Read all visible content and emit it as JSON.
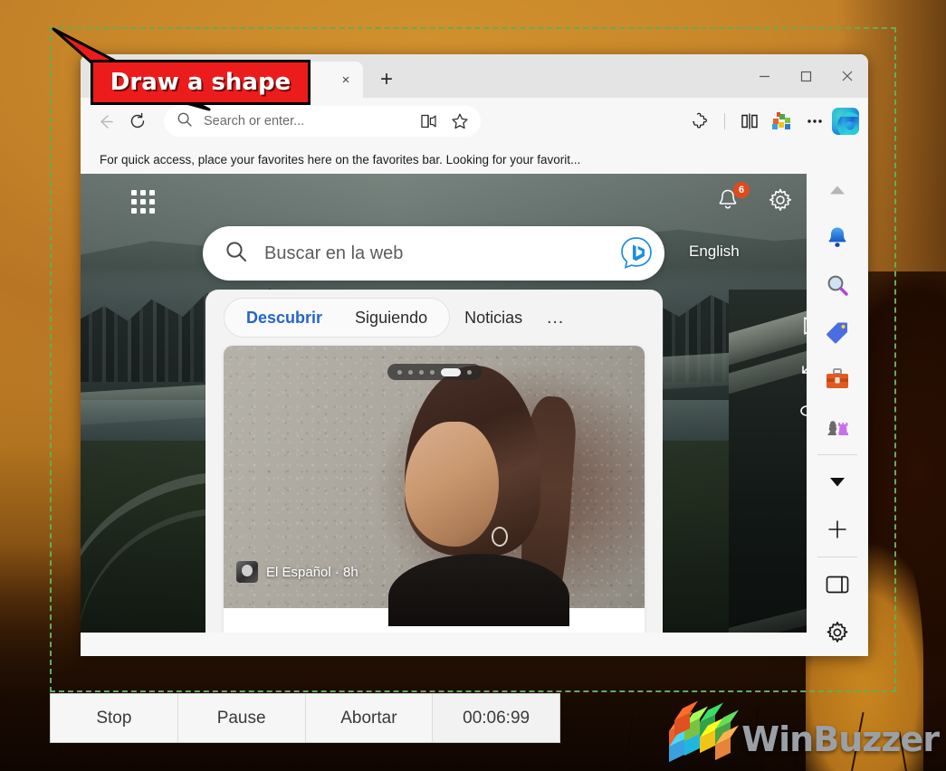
{
  "annotation": {
    "label": "Draw a shape",
    "color": "#ed1c1c"
  },
  "browser": {
    "tab": {
      "title": "",
      "close_label": "×",
      "favicon": "circle-favicon"
    },
    "newtab_label": "+",
    "window_controls": {
      "minimize": "–",
      "maximize": "□",
      "close": "✕"
    },
    "toolbar": {
      "back_icon": "back-arrow-icon",
      "refresh_icon": "refresh-icon",
      "omnibox_placeholder": "Search or enter...",
      "read_aloud_icon": "read-aloud-icon",
      "favorite_icon": "star-icon",
      "extensions_icon": "puzzle-piece-icon",
      "split_screen_icon": "split-screen-icon",
      "collections_icon": "collections-cubes-icon",
      "settings_more_icon": "ellipsis-icon",
      "copilot_icon": "copilot-icon"
    },
    "favorites_bar": {
      "text": "For quick access, place your favorites here on the favorites bar. Looking for your favorit..."
    }
  },
  "bing": {
    "waffle_icon": "app-grid-icon",
    "notifications": {
      "icon": "bell-icon",
      "badge": "6"
    },
    "settings_icon": "gear-icon",
    "search": {
      "placeholder": "Buscar en la web",
      "search_icon": "search-icon",
      "chat_icon": "bing-chat-icon"
    },
    "language": "English",
    "feed": {
      "tabs": [
        {
          "label": "Descubrir",
          "active": true
        },
        {
          "label": "Siguiendo",
          "active": false
        },
        {
          "label": "Noticias",
          "active": false
        }
      ],
      "more_label": "…",
      "card": {
        "source": "El Español · 8h",
        "story_dots": 6,
        "story_active_index": 4
      }
    },
    "video": {
      "play_icon": "play-triangle-icon",
      "expand_icon": "expand-diagonal-icon",
      "react_icon": "reaction-icon"
    },
    "scrollbar": {
      "up": "▲",
      "down": "▼"
    }
  },
  "edge_sidebar": {
    "items": [
      {
        "name": "collapse-chevron",
        "icon": "chevron-up-icon"
      },
      {
        "name": "notifications",
        "icon": "bell-blue-icon"
      },
      {
        "name": "search",
        "icon": "magnifier-icon"
      },
      {
        "name": "shopping",
        "icon": "price-tag-icon"
      },
      {
        "name": "tools",
        "icon": "toolbox-icon"
      },
      {
        "name": "games",
        "icon": "chess-pieces-icon"
      },
      {
        "name": "show-more",
        "icon": "chevron-down-icon"
      },
      {
        "name": "add-app",
        "icon": "plus-icon"
      },
      {
        "name": "sidebar-toggle",
        "icon": "panel-icon"
      },
      {
        "name": "sidebar-settings",
        "icon": "gear-icon"
      }
    ]
  },
  "recorder": {
    "buttons": [
      {
        "label": "Stop",
        "name": "stop"
      },
      {
        "label": "Pause",
        "name": "pause"
      },
      {
        "label": "Abortar",
        "name": "abort"
      }
    ],
    "timer": "00:06:99"
  },
  "watermark": {
    "text": "WinBuzzer"
  },
  "colors": {
    "annotation_red": "#ed1c1c",
    "capture_border_green": "#2f8f1e",
    "bing_tab_active_blue": "#2566c8",
    "badge_orange": "#e14a1e",
    "wallpaper_orange": "#c8862a"
  }
}
